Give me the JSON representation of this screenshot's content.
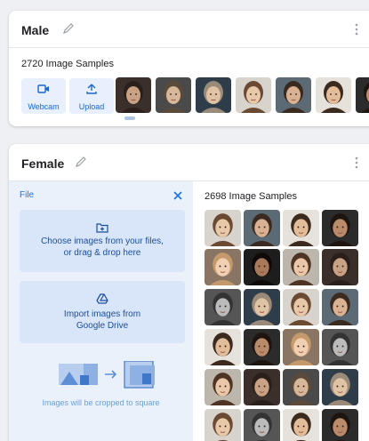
{
  "male": {
    "title": "Male",
    "samples": "2720 Image Samples",
    "buttons": {
      "webcam": "Webcam",
      "upload": "Upload"
    },
    "thumbnails": 7
  },
  "female": {
    "title": "Female",
    "samples": "2698 Image Samples",
    "panel": {
      "title": "File",
      "choose_line1": "Choose images from your files,",
      "choose_line2": "or drag & drop here",
      "drive_line1": "Import images from",
      "drive_line2": "Google Drive",
      "crop_note": "Images will be cropped to square"
    },
    "grid_rows": 6,
    "grid_cols": 4
  },
  "colors": {
    "accent": "#1a73e8",
    "button_bg": "#e8f0fe",
    "panel_bg": "#eaf1fb",
    "drop_box_bg": "#d9e5f8"
  },
  "icons": [
    "pencil-icon",
    "more-vert-icon",
    "webcam-icon",
    "upload-icon",
    "close-icon",
    "folder-add-icon",
    "google-drive-icon",
    "crop-illustration-icon"
  ]
}
